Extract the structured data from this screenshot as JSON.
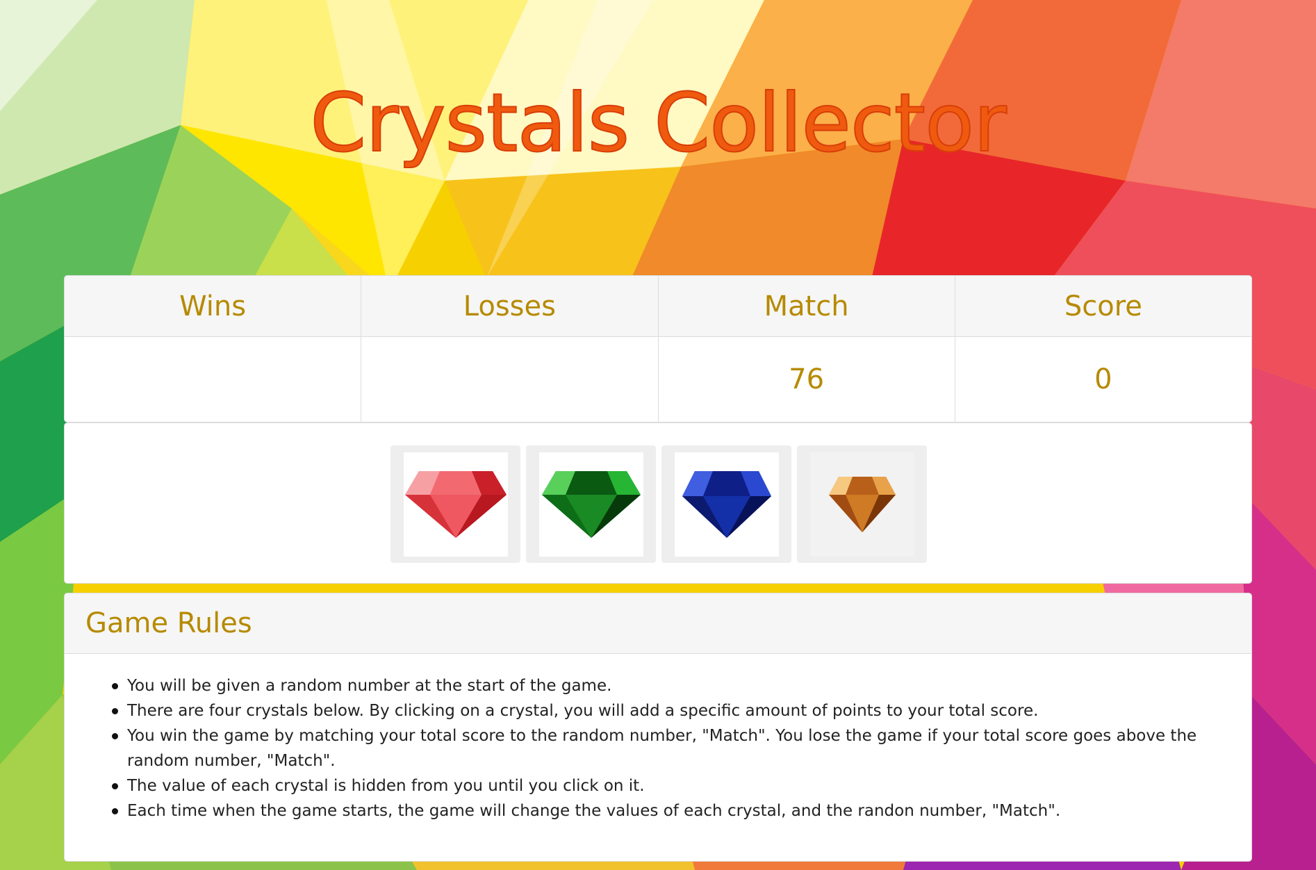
{
  "title": "Crystals Collector",
  "stats": {
    "wins": {
      "label": "Wins",
      "value": ""
    },
    "losses": {
      "label": "Losses",
      "value": ""
    },
    "match": {
      "label": "Match",
      "value": "76"
    },
    "score": {
      "label": "Score",
      "value": "0"
    }
  },
  "crystals": [
    {
      "name": "red-crystal",
      "color": "#e8444c"
    },
    {
      "name": "green-crystal",
      "color": "#1f9e2a"
    },
    {
      "name": "blue-crystal",
      "color": "#1a34b8"
    },
    {
      "name": "orange-crystal",
      "color": "#d9862a"
    }
  ],
  "rules": {
    "heading": "Game Rules",
    "items": [
      "You will be given a random number at the start of the game.",
      "There are four crystals below. By clicking on a crystal, you will add a specific amount of points to your total score.",
      "You win the game by matching your total score to the random number, \"Match\". You lose the game if your total score goes above the random number, \"Match\".",
      "The value of each crystal is hidden from you until you click on it.",
      "Each time when the game starts, the game will change the values of each crystal, and the randon number, \"Match\"."
    ]
  },
  "colors": {
    "accent": "#b68a00",
    "title": "#ef5a0f"
  }
}
